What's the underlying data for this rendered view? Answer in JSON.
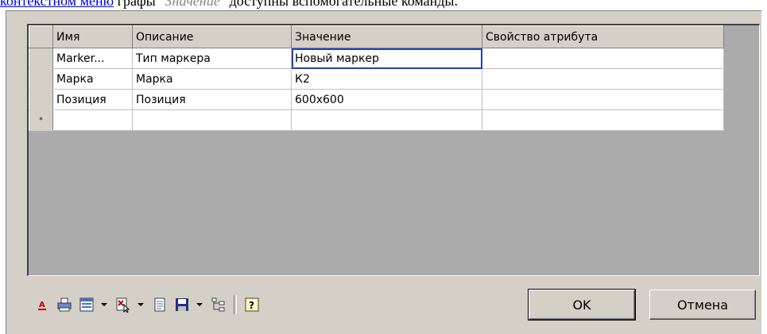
{
  "doc": {
    "link_text": "контекстном меню",
    "text_before_italic": " графы \"",
    "italic_text": "Значение",
    "text_after": "\" доступны вспомогательные команды."
  },
  "grid": {
    "headers": [
      "Имя",
      "Описание",
      "Значение",
      "Свойство атрибута"
    ],
    "rows": [
      {
        "name": "Marker...",
        "description": "Тип маркера",
        "value": "Новый маркер",
        "attr": ""
      },
      {
        "name": "Марка",
        "description": "Марка",
        "value": "К2",
        "attr": ""
      },
      {
        "name": "Позиция",
        "description": "Позиция",
        "value": "600x600",
        "attr": ""
      }
    ],
    "new_row_marker": "*"
  },
  "toolbar": {
    "icons": [
      "font-icon",
      "print-icon",
      "columns-icon",
      "delete-icon",
      "copy-icon",
      "save-icon",
      "tree-icon",
      "help-icon"
    ]
  },
  "buttons": {
    "ok": "OK",
    "cancel": "Отмена"
  },
  "colors": {
    "dialog_bg": "#d4d0c8",
    "selection": "#2040c8"
  }
}
